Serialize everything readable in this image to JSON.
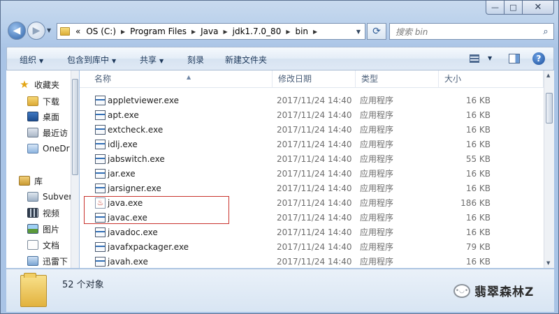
{
  "caption": {
    "minimize": "—",
    "maximize": "□",
    "close": "✕"
  },
  "address": {
    "overflow": "«",
    "crumbs": [
      "OS (C:)",
      "Program Files",
      "Java",
      "jdk1.7.0_80",
      "bin"
    ]
  },
  "search": {
    "placeholder": "搜索 bin"
  },
  "toolbar": {
    "organize": "组织",
    "include_in_library": "包含到库中",
    "share": "共享",
    "burn": "刻录",
    "new_folder": "新建文件夹"
  },
  "nav": {
    "items": [
      {
        "label": "收藏夹",
        "icon": "star-icon"
      },
      {
        "label": "下载",
        "icon": "download-folder-icon"
      },
      {
        "label": "桌面",
        "icon": "desktop-icon"
      },
      {
        "label": "最近访",
        "icon": "recent-places-icon"
      },
      {
        "label": "OneDr",
        "icon": "onedrive-icon"
      },
      {
        "label": "库",
        "icon": "library-icon"
      },
      {
        "label": "Subver",
        "icon": "subversion-icon"
      },
      {
        "label": "视频",
        "icon": "video-icon"
      },
      {
        "label": "图片",
        "icon": "pictures-icon"
      },
      {
        "label": "文档",
        "icon": "documents-icon"
      },
      {
        "label": "迅雷下",
        "icon": "thunder-download-icon"
      }
    ]
  },
  "columns": {
    "name": "名称",
    "modified": "修改日期",
    "type": "类型",
    "size": "大小"
  },
  "files": [
    {
      "name": "appletviewer.exe",
      "modified": "2017/11/24 14:40",
      "type": "应用程序",
      "size": "16 KB",
      "icon": "exe-icon"
    },
    {
      "name": "apt.exe",
      "modified": "2017/11/24 14:40",
      "type": "应用程序",
      "size": "16 KB",
      "icon": "exe-icon"
    },
    {
      "name": "extcheck.exe",
      "modified": "2017/11/24 14:40",
      "type": "应用程序",
      "size": "16 KB",
      "icon": "exe-icon"
    },
    {
      "name": "idlj.exe",
      "modified": "2017/11/24 14:40",
      "type": "应用程序",
      "size": "16 KB",
      "icon": "exe-icon"
    },
    {
      "name": "jabswitch.exe",
      "modified": "2017/11/24 14:40",
      "type": "应用程序",
      "size": "55 KB",
      "icon": "exe-icon"
    },
    {
      "name": "jar.exe",
      "modified": "2017/11/24 14:40",
      "type": "应用程序",
      "size": "16 KB",
      "icon": "exe-icon"
    },
    {
      "name": "jarsigner.exe",
      "modified": "2017/11/24 14:40",
      "type": "应用程序",
      "size": "16 KB",
      "icon": "exe-icon"
    },
    {
      "name": "java.exe",
      "modified": "2017/11/24 14:40",
      "type": "应用程序",
      "size": "186 KB",
      "icon": "java-icon"
    },
    {
      "name": "javac.exe",
      "modified": "2017/11/24 14:40",
      "type": "应用程序",
      "size": "16 KB",
      "icon": "exe-icon"
    },
    {
      "name": "javadoc.exe",
      "modified": "2017/11/24 14:40",
      "type": "应用程序",
      "size": "16 KB",
      "icon": "exe-icon"
    },
    {
      "name": "javafxpackager.exe",
      "modified": "2017/11/24 14:40",
      "type": "应用程序",
      "size": "79 KB",
      "icon": "exe-icon"
    },
    {
      "name": "javah.exe",
      "modified": "2017/11/24 14:40",
      "type": "应用程序",
      "size": "16 KB",
      "icon": "exe-icon"
    }
  ],
  "details": {
    "item_count": "52 个对象"
  },
  "watermark": {
    "text": "翡翠森林Z"
  },
  "colors": {
    "highlight_border": "#c9332d",
    "window_frame": "#bcd2ec"
  }
}
